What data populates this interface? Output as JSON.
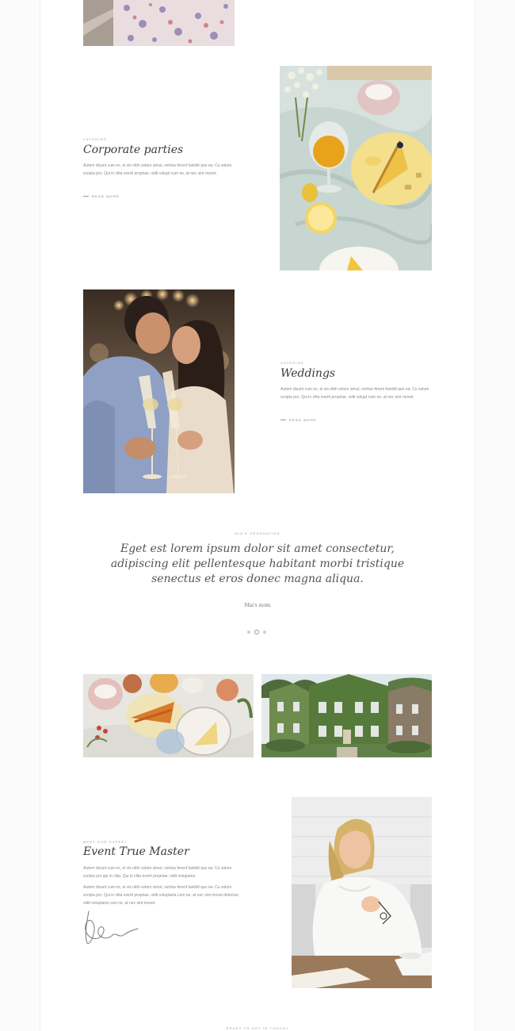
{
  "corporate": {
    "kicker": "CATERING",
    "title": "Corporate parties",
    "body": "Autem dicant cum ex, ei vis nibh solum simul, veritus ferent fastidii quo ea. Cu solum scripta pro. Qui in clita everti propriae, vidit volupt cum ne, at nec sint movet.",
    "read_more": "READ MORE"
  },
  "weddings": {
    "kicker": "CATERING",
    "title": "Weddings",
    "body": "Autem dicant cum ex, ei vis nibh solum simul, veritus ferent fastidii quo ea. Cu solum scripta pro. Qui in clita everti propriae, vidit volupt cum ne, at nec sint movet.",
    "read_more": "READ MORE"
  },
  "testimonial": {
    "kicker": "MIA'S GRADUATION",
    "quote": "Eget est lorem ipsum dolor sit amet consectetur, adipiscing elit pellentesque habitant morbi tristique senectus et eros donec magna aliqua.",
    "author": "Mia's mom",
    "active_slide": 2,
    "slide_count": 3
  },
  "expert": {
    "kicker": "MEET OUR EXPERT",
    "title": "Event True Master",
    "body1": "Autem dicant cum ex, ei vis nibh solum simul, veritus ferent fastidii quo ea. Cu solum scripta pro qui in clita. Qui in clita everti propriae, vidit voluptaria.",
    "body2": "Autem dicant cum ex, ei vis nibh solum simul, veritus ferent fastidii quo ea. Cu solum scripta pro. Qui in clita everti propriae, vidit voluptaria cum ne, at nec sint movet delectus vidit voluptaria cum ne, at nec sint movet."
  },
  "footer": {
    "kicker": "READY TO GET IN TOUCH?"
  },
  "colors": {
    "background": "#fbfbfb",
    "frame": "#ffffff",
    "heading": "#3a3a3a",
    "muted_text": "#8a8a8a"
  }
}
